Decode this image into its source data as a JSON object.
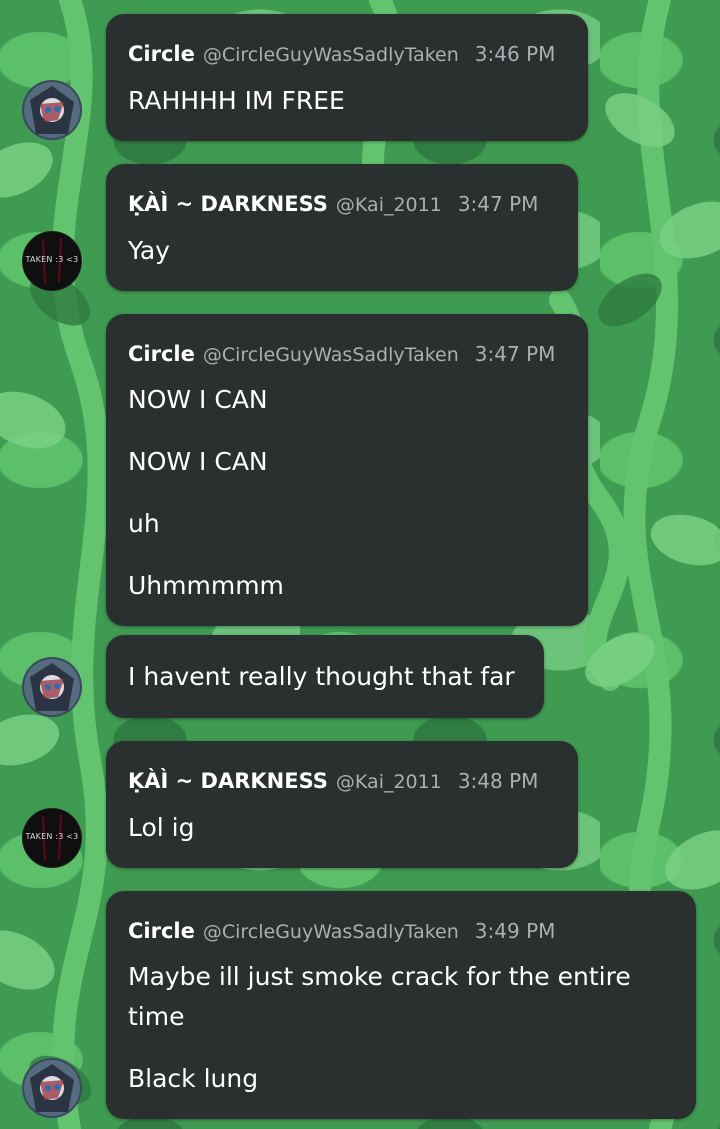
{
  "colors": {
    "bubble": "#2a2f2f",
    "name": "#ffffff",
    "meta": "#a9b0b1",
    "background": "#3f9a52"
  },
  "avatars": {
    "circle": {
      "icon": "anime-character-avatar-icon"
    },
    "kai": {
      "icon": "taken-avatar-icon",
      "text": "TAKEN :3 <3"
    }
  },
  "messages": [
    {
      "author": "Circle",
      "handle": "@CircleGuyWasSadlyTaken",
      "time": "3:46 PM",
      "lines": [
        "RAHHHH IM FREE"
      ]
    },
    {
      "author": "ḲÀÌ ~ DARKNESS",
      "handle": "@Kai_2011",
      "time": "3:47 PM",
      "lines": [
        "Yay"
      ]
    },
    {
      "author": "Circle",
      "handle": "@CircleGuyWasSadlyTaken",
      "time": "3:47 PM",
      "lines": [
        "NOW I CAN",
        "NOW I CAN",
        "uh",
        "Uhmmmmm"
      ]
    },
    {
      "lines": [
        "I havent really thought that far"
      ]
    },
    {
      "author": "ḲÀÌ ~ DARKNESS",
      "handle": "@Kai_2011",
      "time": "3:48 PM",
      "lines": [
        "Lol ig"
      ]
    },
    {
      "author": "Circle",
      "handle": "@CircleGuyWasSadlyTaken",
      "time": "3:49 PM",
      "lines": [
        "Maybe ill just smoke crack for the entire",
        "time",
        "Black lung"
      ]
    }
  ]
}
